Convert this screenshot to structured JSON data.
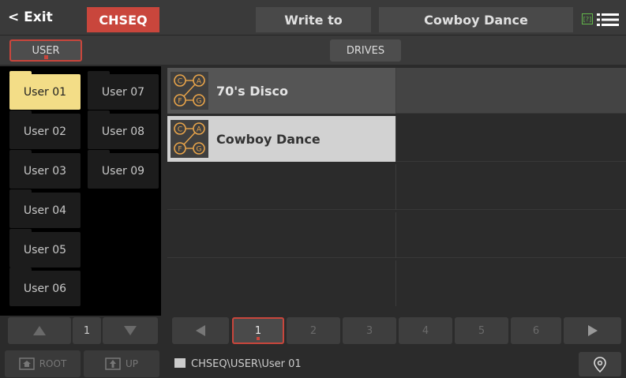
{
  "topbar": {
    "exit_label": "< Exit",
    "mode_label": "CHSEQ",
    "write_label": "Write to",
    "song_title": "Cowboy Dance",
    "help_icon": "help-icon",
    "menu_icon": "menu-icon"
  },
  "tabs": {
    "user": "USER",
    "drives": "DRIVES"
  },
  "folders": [
    "User 01",
    "User 02",
    "User 03",
    "User 04",
    "User 05",
    "User 06",
    "User 07",
    "User 08",
    "User 09"
  ],
  "selected_folder": "User 01",
  "files": [
    {
      "name": "70's Disco",
      "icon": "chord-sequence-icon"
    },
    {
      "name": "Cowboy Dance",
      "icon": "chord-sequence-icon",
      "selected": true
    }
  ],
  "folder_pager": {
    "current": "1"
  },
  "file_pager": {
    "pages": [
      "1",
      "2",
      "3",
      "4",
      "5",
      "6"
    ],
    "current": "1"
  },
  "bottom": {
    "root_label": "ROOT",
    "up_label": "UP",
    "path": "CHSEQ\\USER\\User 01"
  },
  "colors": {
    "accent": "#c9463c",
    "selection_yellow": "#f3dd87",
    "selected_row": "#d2d2d2",
    "help_green": "#63b84b"
  }
}
